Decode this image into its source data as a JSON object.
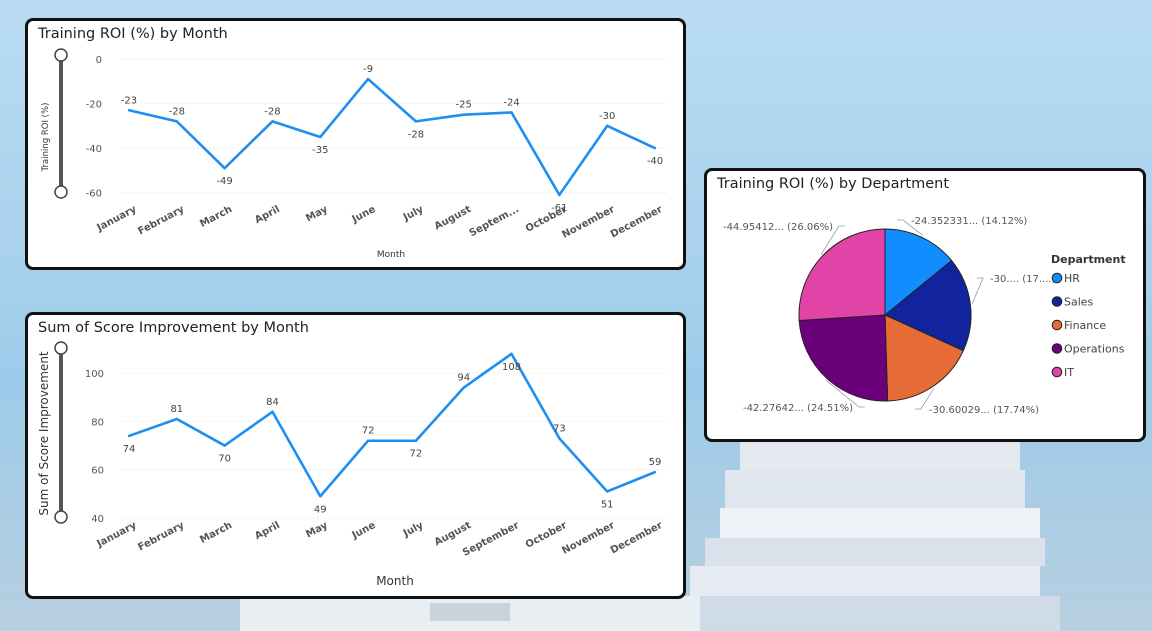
{
  "colors": {
    "line": "#1e8ff0",
    "HR": "#118dff",
    "Sales": "#12239e",
    "Finance": "#e66c37",
    "Operations": "#6b007b",
    "IT": "#e044a7"
  },
  "chart_data": [
    {
      "type": "line",
      "title": "Training ROI (%) by Month",
      "xlabel": "Month",
      "ylabel": "Training ROI (%)",
      "ylim": [
        -70,
        0
      ],
      "yticks": [
        0,
        -20,
        -40,
        -60
      ],
      "categories": [
        "January",
        "February",
        "March",
        "April",
        "May",
        "June",
        "July",
        "August",
        "Septem...",
        "October",
        "November",
        "December"
      ],
      "values": [
        -23,
        -28,
        -49,
        -28,
        -35,
        -9,
        -28,
        -25,
        -24,
        -61,
        -30,
        -40
      ],
      "data_labels": [
        "-23",
        "-28",
        "-49",
        "-28",
        "-35",
        "-9",
        "-28",
        "-25",
        "-24",
        "-61",
        "-30",
        "-40"
      ],
      "grid": true
    },
    {
      "type": "line",
      "title": "Sum of Score Improvement by Month",
      "xlabel": "Month",
      "ylabel": "Sum of Score Improvement",
      "ylim": [
        40,
        110
      ],
      "yticks": [
        100,
        80,
        60,
        40
      ],
      "categories": [
        "January",
        "February",
        "March",
        "April",
        "May",
        "June",
        "July",
        "August",
        "September",
        "October",
        "November",
        "December"
      ],
      "values": [
        74,
        81,
        70,
        84,
        49,
        72,
        72,
        94,
        108,
        73,
        51,
        59
      ],
      "data_labels": [
        "74",
        "81",
        "70",
        "84",
        "49",
        "72",
        "72",
        "94",
        "108",
        "73",
        "51",
        "59"
      ],
      "grid": true
    },
    {
      "type": "pie",
      "title": "Training ROI (%) by Department",
      "legend_title": "Department",
      "legend_position": "right",
      "categories": [
        "HR",
        "Sales",
        "Finance",
        "Operations",
        "IT"
      ],
      "values": [
        -24.352331,
        -30.6,
        -30.60029,
        -42.27642,
        -44.95412
      ],
      "percentages": [
        14.12,
        17.74,
        17.74,
        24.51,
        26.06
      ],
      "data_labels": [
        "-24.352331... (14.12%)",
        "-30.... (17....)",
        "-30.60029... (17.74%)",
        "-42.27642... (24.51%)",
        "-44.95412... (26.06%)"
      ]
    }
  ]
}
